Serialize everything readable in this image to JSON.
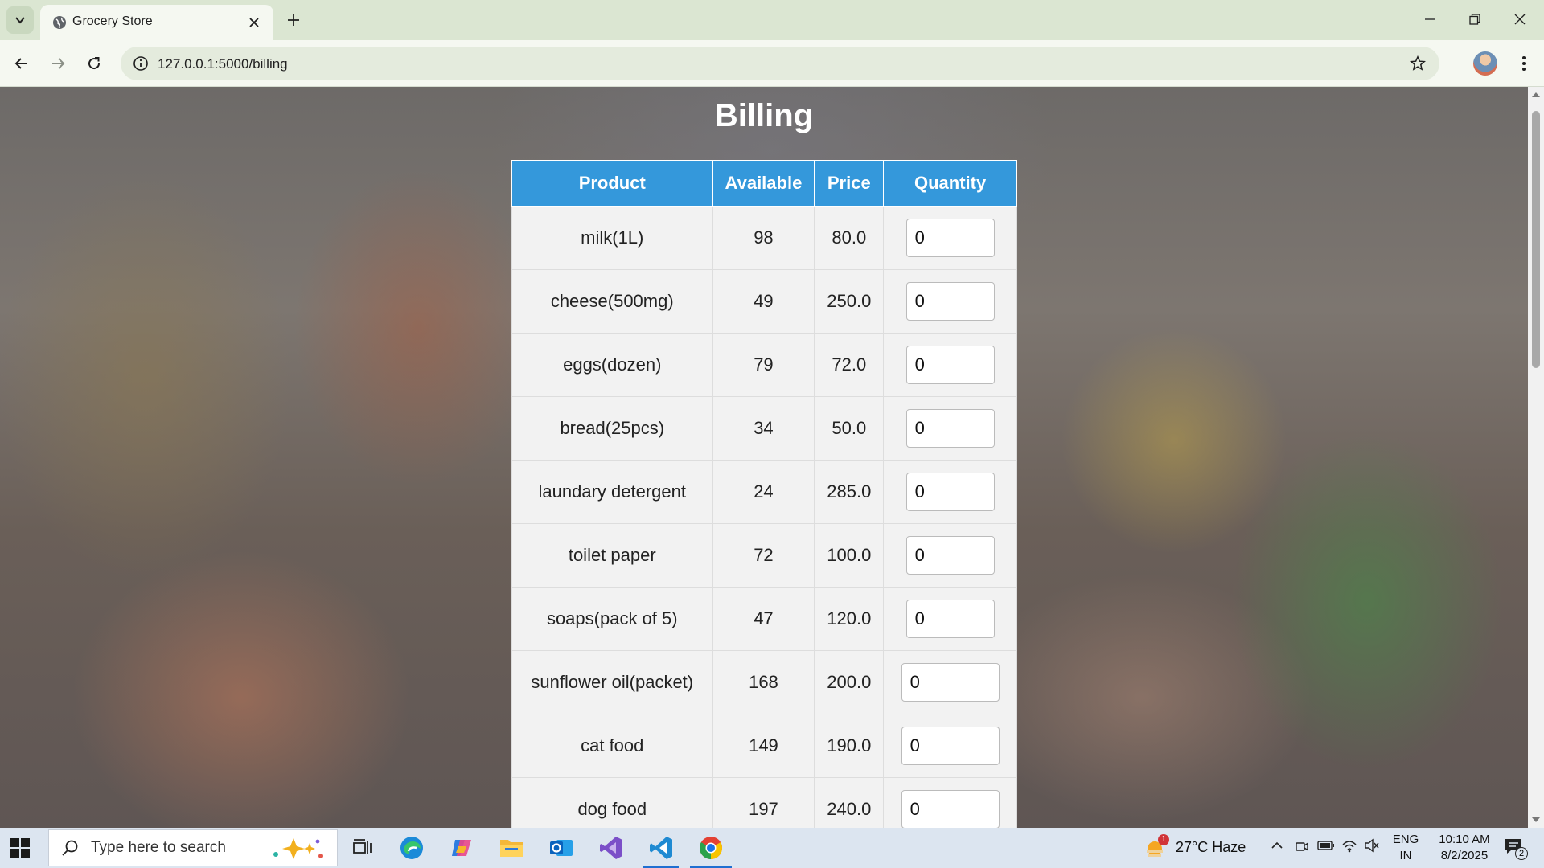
{
  "browser": {
    "tab_title": "Grocery Store",
    "url": "127.0.0.1:5000/billing"
  },
  "page": {
    "title": "Billing",
    "headers": [
      "Product",
      "Available",
      "Price",
      "Quantity"
    ],
    "rows": [
      {
        "product": "milk(1L)",
        "available": "98",
        "price": "80.0",
        "quantity": "0"
      },
      {
        "product": "cheese(500mg)",
        "available": "49",
        "price": "250.0",
        "quantity": "0"
      },
      {
        "product": "eggs(dozen)",
        "available": "79",
        "price": "72.0",
        "quantity": "0"
      },
      {
        "product": "bread(25pcs)",
        "available": "34",
        "price": "50.0",
        "quantity": "0"
      },
      {
        "product": "laundary detergent",
        "available": "24",
        "price": "285.0",
        "quantity": "0"
      },
      {
        "product": "toilet paper",
        "available": "72",
        "price": "100.0",
        "quantity": "0"
      },
      {
        "product": "soaps(pack of 5)",
        "available": "47",
        "price": "120.0",
        "quantity": "0"
      },
      {
        "product": "sunflower oil(packet)",
        "available": "168",
        "price": "200.0",
        "quantity": "0"
      },
      {
        "product": "cat food",
        "available": "149",
        "price": "190.0",
        "quantity": "0"
      },
      {
        "product": "dog food",
        "available": "197",
        "price": "240.0",
        "quantity": "0"
      }
    ]
  },
  "taskbar": {
    "search_placeholder": "Type here to search",
    "weather": "27°C  Haze",
    "weather_badge": "1",
    "lang_top": "ENG",
    "lang_bottom": "IN",
    "time": "10:10 AM",
    "date": "8/2/2025",
    "notification_count": "2",
    "apps": [
      "task-view",
      "edge",
      "copilot",
      "file-explorer",
      "outlook",
      "visual-studio",
      "vscode",
      "chrome"
    ]
  },
  "colors": {
    "table_header": "#3498db",
    "table_body": "#f2f2f2",
    "title_text": "#ffffff",
    "chrome_frame": "#dbe6d2"
  }
}
